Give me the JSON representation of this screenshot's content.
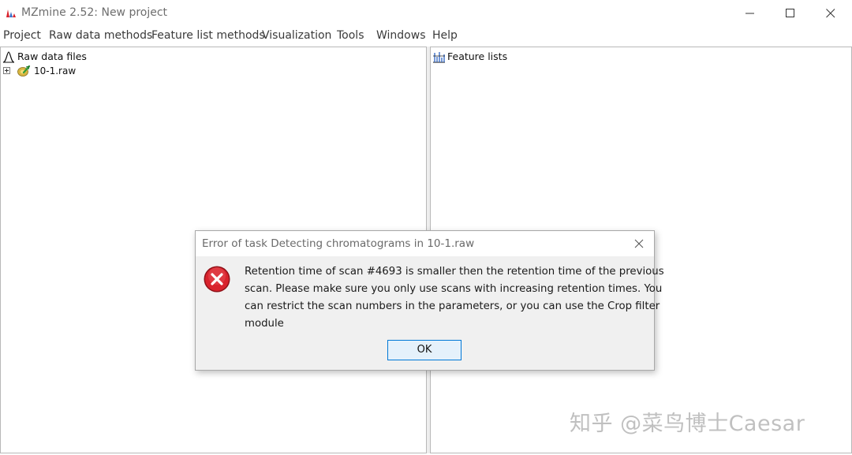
{
  "window": {
    "title": "MZmine 2.52: New project"
  },
  "menubar": {
    "items": [
      {
        "label": "Project"
      },
      {
        "label": "Raw data methods"
      },
      {
        "label": "Feature list methods"
      },
      {
        "label": "Visualization"
      },
      {
        "label": "Tools"
      },
      {
        "label": "Windows"
      },
      {
        "label": "Help"
      }
    ]
  },
  "left_panel": {
    "root_label": "Raw data files",
    "root_icon": "peak-icon",
    "files": [
      {
        "label": "10-1.raw",
        "icon": "raw-file-icon"
      }
    ]
  },
  "right_panel": {
    "root_label": "Feature lists",
    "root_icon": "feature-list-icon"
  },
  "dialog": {
    "title": "Error of task Detecting chromatograms in 10-1.raw",
    "icon": "error-icon",
    "message_lines": [
      "Retention time of scan #4693 is smaller then the retention time of the previous",
      "scan. Please make sure you only use scans with increasing retention times. You",
      "can restrict the scan numbers in the parameters, or you can use the Crop filter",
      "module"
    ],
    "ok_label": "OK"
  },
  "watermark": {
    "text": "知乎 @菜鸟博士Caesar"
  },
  "colors": {
    "error_red": "#d9232d",
    "button_accent": "#0078d7"
  }
}
